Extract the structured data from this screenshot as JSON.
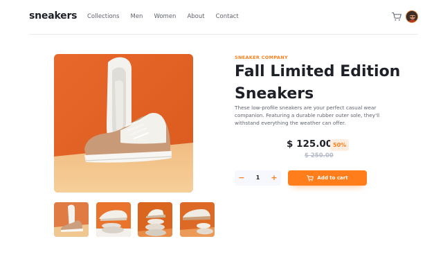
{
  "header": {
    "logo": "sneakers",
    "nav": [
      "Collections",
      "Men",
      "Women",
      "About",
      "Contact"
    ]
  },
  "product": {
    "company": "SNEAKER COMPANY",
    "title": "Fall Limited Edition Sneakers",
    "description": "These low-profile sneakers are your perfect casual wear companion. Featuring a durable rubber outer sole, they'll withstand everything the weather can offer.",
    "price": "$ 125.00",
    "discount": "50%",
    "old_price": "$ 250.00",
    "quantity": "1",
    "minus": "−",
    "plus": "+",
    "add_to_cart": "Add to cart"
  },
  "icons": {
    "cart": "cart-icon",
    "avatar": "user-avatar",
    "minus": "minus-icon",
    "plus": "plus-icon"
  },
  "colors": {
    "accent": "#ff7e1b",
    "accent_pale": "#ffede0",
    "text_dark": "#1d2026",
    "text_muted": "#5f6370",
    "strike": "#b6bcc8",
    "image_orange": "#e06a22",
    "image_floor": "#f2c48a"
  },
  "gallery": {
    "selected_index": 0,
    "thumbnails": [
      "thumbnail-1",
      "thumbnail-2",
      "thumbnail-3",
      "thumbnail-4"
    ]
  }
}
